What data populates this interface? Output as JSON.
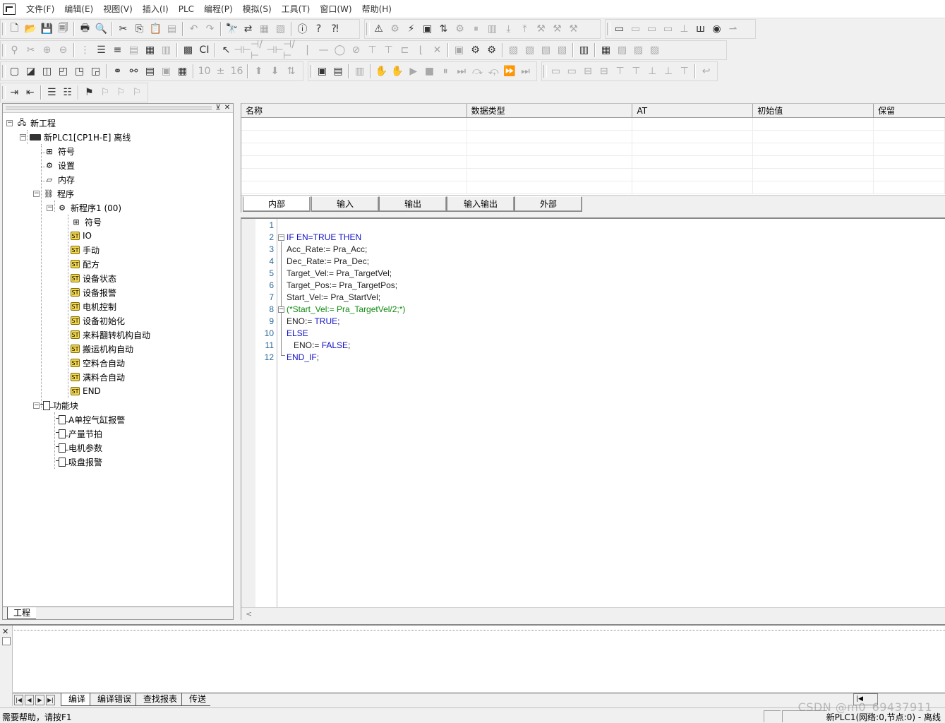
{
  "menu": [
    "文件(F)",
    "编辑(E)",
    "视图(V)",
    "插入(I)",
    "PLC",
    "编程(P)",
    "模拟(S)",
    "工具(T)",
    "窗口(W)",
    "帮助(H)"
  ],
  "tree": {
    "root": "新工程",
    "plc": "新PLC1[CP1H-E] 离线",
    "symbols": "符号",
    "settings": "设置",
    "memory": "内存",
    "programs": "程序",
    "program1": "新程序1 (00)",
    "sections": [
      "符号",
      "IO",
      "手动",
      "配方",
      "设备状态",
      "设备报警",
      "电机控制",
      "设备初始化",
      "来料翻转机构自动",
      "搬运机构自动",
      "空料合自动",
      "满料合自动",
      "END"
    ],
    "function_blocks": "功能块",
    "fb_items": [
      "A单控气缸报警",
      "产量节拍",
      "电机参数",
      "吸盘报警"
    ],
    "tab": "工程"
  },
  "var_table": {
    "columns": [
      "名称",
      "数据类型",
      "AT",
      "初始值",
      "保留"
    ],
    "tabs": [
      "内部",
      "输入",
      "输出",
      "输入输出",
      "外部"
    ]
  },
  "code": {
    "line_numbers": [
      "1",
      "2",
      "3",
      "4",
      "5",
      "6",
      "7",
      "8",
      "9",
      "10",
      "11",
      "12"
    ],
    "lines": [
      {
        "n": "1",
        "parts": []
      },
      {
        "n": "2",
        "parts": [
          {
            "t": "IF EN=TRUE THEN",
            "c": "kw"
          }
        ]
      },
      {
        "n": "3",
        "parts": [
          {
            "t": "Acc_Rate:= Pra_Acc;",
            "c": ""
          }
        ]
      },
      {
        "n": "4",
        "parts": [
          {
            "t": "Dec_Rate:= Pra_Dec;",
            "c": ""
          }
        ]
      },
      {
        "n": "5",
        "parts": [
          {
            "t": "Target_Vel:= Pra_TargetVel;",
            "c": ""
          }
        ]
      },
      {
        "n": "6",
        "parts": [
          {
            "t": "Target_Pos:= Pra_TargetPos;",
            "c": ""
          }
        ]
      },
      {
        "n": "7",
        "parts": [
          {
            "t": "Start_Vel:= Pra_StartVel;",
            "c": ""
          }
        ]
      },
      {
        "n": "8",
        "parts": [
          {
            "t": "(*Start_Vel:= Pra_TargetVel/2;*)",
            "c": "cm"
          }
        ]
      },
      {
        "n": "9",
        "parts": [
          {
            "t": "ENO:= ",
            "c": ""
          },
          {
            "t": "TRUE",
            "c": "kw"
          },
          {
            "t": ";",
            "c": ""
          }
        ]
      },
      {
        "n": "10",
        "parts": [
          {
            "t": "ELSE",
            "c": "kw"
          }
        ]
      },
      {
        "n": "11",
        "parts": [
          {
            "t": "   ENO:= ",
            "c": ""
          },
          {
            "t": "FALSE",
            "c": "kw"
          },
          {
            "t": ";",
            "c": ""
          }
        ]
      },
      {
        "n": "12",
        "parts": [
          {
            "t": "END_IF",
            "c": "kw"
          },
          {
            "t": ";",
            "c": ""
          }
        ]
      }
    ]
  },
  "output": {
    "tabs": [
      "编译",
      "编译错误",
      "查找报表",
      "传送"
    ]
  },
  "status": {
    "help": "需要帮助，请按F1",
    "right": "新PLC1(网络:0,节点:0) - 离线"
  },
  "watermark": "CSDN @m0_69437911",
  "colors": {
    "keyword": "#1010c8",
    "comment": "#118a11",
    "line_number": "#2a6a9a"
  }
}
